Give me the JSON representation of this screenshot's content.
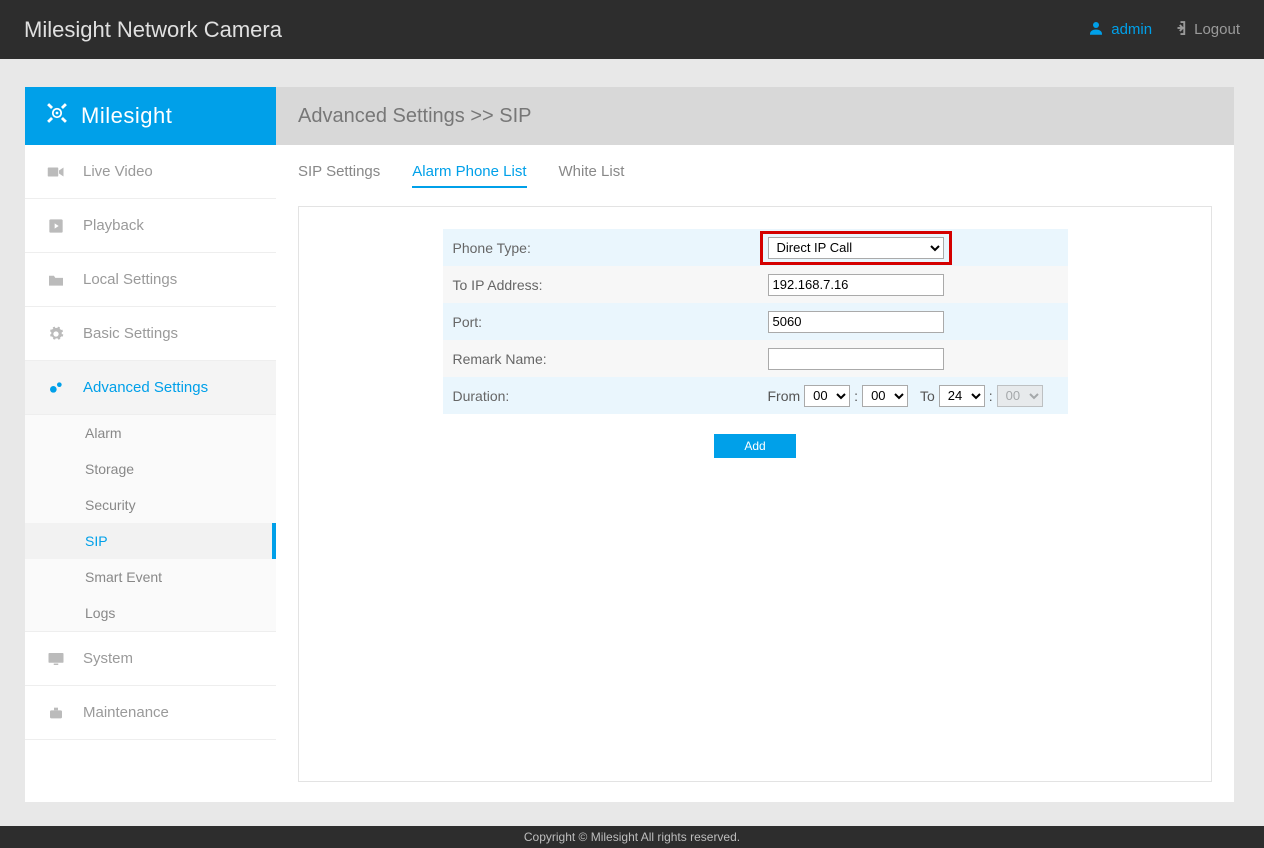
{
  "topbar": {
    "title": "Milesight Network Camera",
    "username": "admin",
    "logout": "Logout"
  },
  "brand": "Milesight",
  "sidebar": {
    "items": [
      {
        "label": "Live Video"
      },
      {
        "label": "Playback"
      },
      {
        "label": "Local Settings"
      },
      {
        "label": "Basic Settings"
      },
      {
        "label": "Advanced Settings",
        "active": true
      },
      {
        "label": "System"
      },
      {
        "label": "Maintenance"
      }
    ],
    "advanced_sub": [
      {
        "label": "Alarm"
      },
      {
        "label": "Storage"
      },
      {
        "label": "Security"
      },
      {
        "label": "SIP",
        "active": true
      },
      {
        "label": "Smart Event"
      },
      {
        "label": "Logs"
      }
    ]
  },
  "main": {
    "breadcrumb": "Advanced Settings >> SIP",
    "tabs": [
      {
        "label": "SIP Settings"
      },
      {
        "label": "Alarm Phone List",
        "active": true
      },
      {
        "label": "White List"
      }
    ],
    "form": {
      "phone_type_label": "Phone Type:",
      "phone_type_value": "Direct IP Call",
      "to_ip_label": "To IP Address:",
      "to_ip_value": "192.168.7.16",
      "port_label": "Port:",
      "port_value": "5060",
      "remark_label": "Remark Name:",
      "remark_value": "",
      "duration_label": "Duration:",
      "from_text": "From",
      "to_text": "To",
      "from_h": "00",
      "from_m": "00",
      "to_h": "24",
      "to_m": "00",
      "add_button": "Add"
    }
  },
  "footer": "Copyright © Milesight All rights reserved."
}
